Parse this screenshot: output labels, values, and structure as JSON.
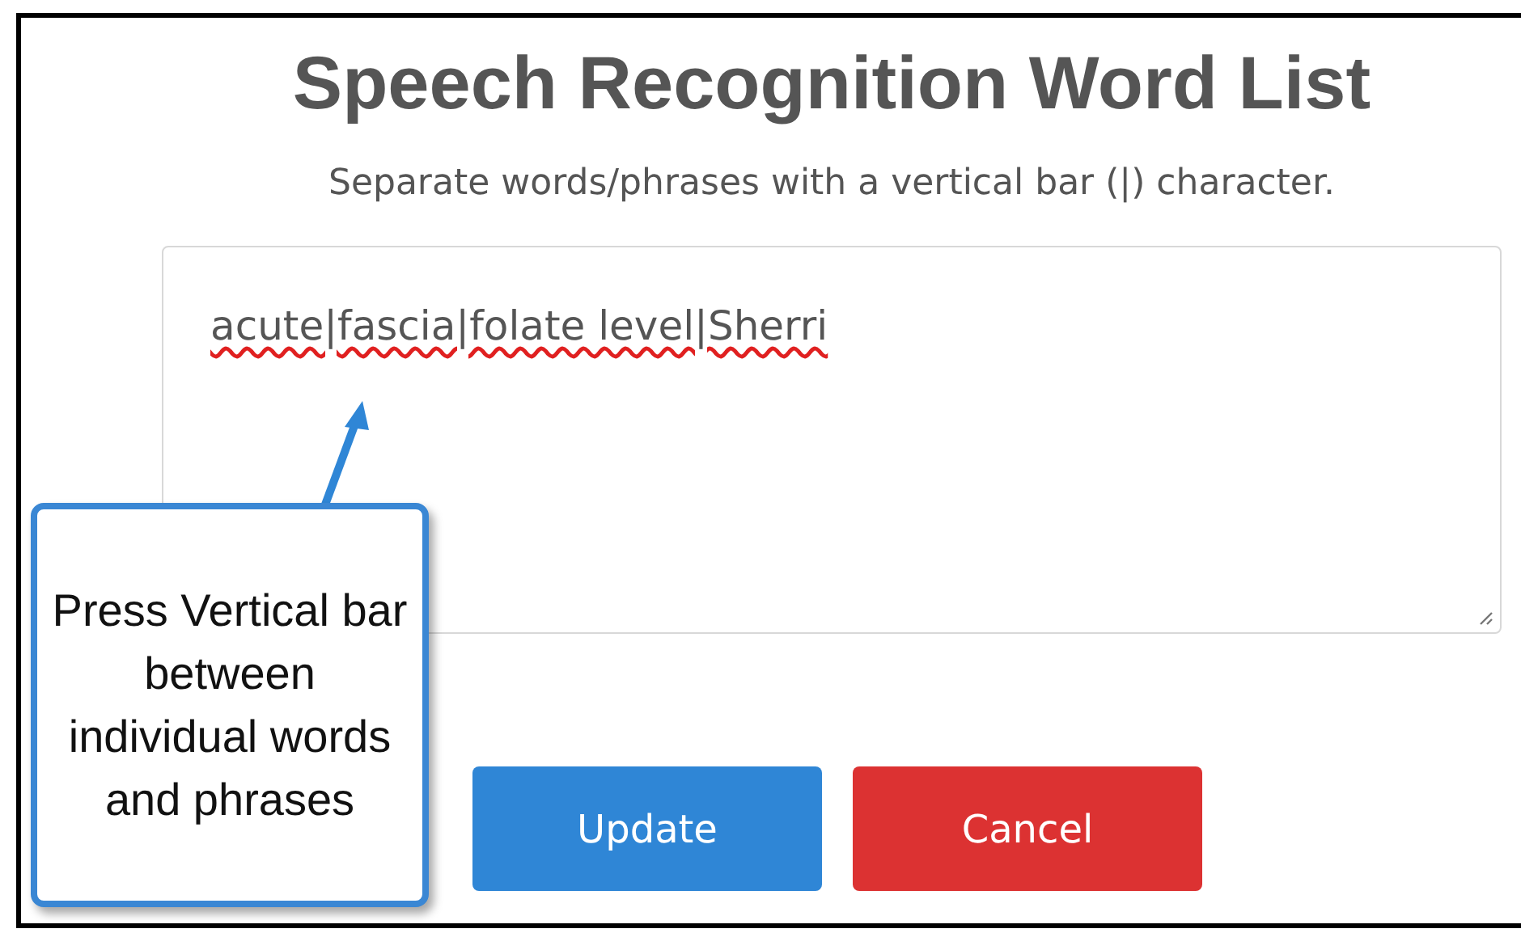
{
  "title": "Speech Recognition Word List",
  "instructions": "Separate words/phrases with a vertical bar (|) character.",
  "word_list": {
    "value": "acute|fascia|folate level|Sherri"
  },
  "callout": {
    "text": "Press Vertical bar between individual words and phrases"
  },
  "buttons": [
    {
      "label": "Update",
      "kind": "primary"
    },
    {
      "label": "Cancel",
      "kind": "danger"
    }
  ]
}
